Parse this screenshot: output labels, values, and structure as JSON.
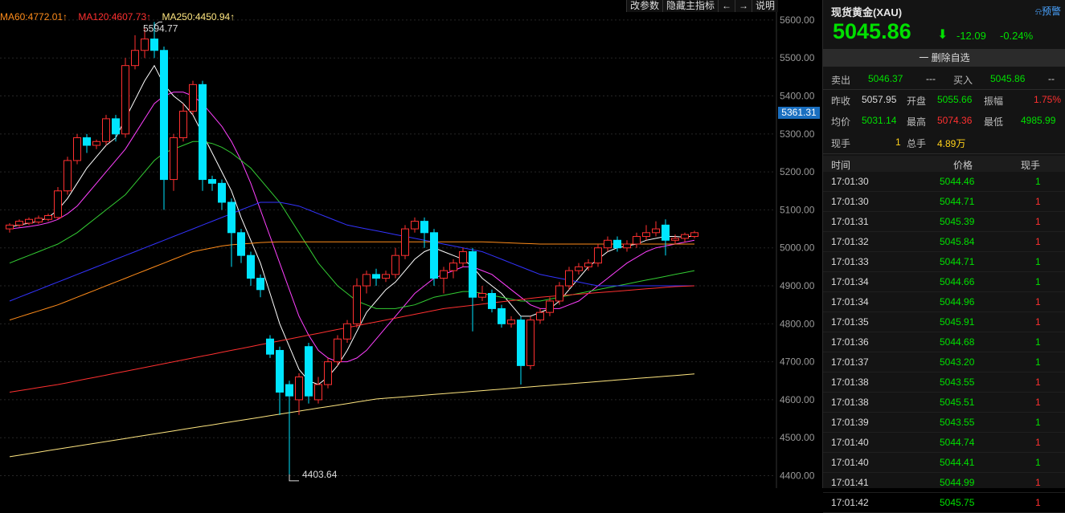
{
  "toolbar": {
    "buttons": [
      "改参数",
      "隐藏主指标",
      "←",
      "→",
      "说明"
    ]
  },
  "ma_legend": [
    {
      "label": "MA60:4772.01↑",
      "color": "#ff8c1a"
    },
    {
      "label": "MA120:4607.73↑",
      "color": "#ff3030"
    },
    {
      "label": "MA250:4450.94↑",
      "color": "#ffe680"
    }
  ],
  "chart_data": {
    "type": "candlestick",
    "y_ticks": [
      5600,
      5500,
      5400,
      5300,
      5200,
      5100,
      5000,
      4900,
      4800,
      4700,
      4600,
      4500,
      4400
    ],
    "y_tick_labels": [
      "5600.00",
      "5500.00",
      "5400.00",
      "5300.00",
      "5200.00",
      "5100.00",
      "5000.00",
      "4900.00",
      "4800.00",
      "4700.00",
      "4600.00",
      "4500.00",
      "4400.00"
    ],
    "ylim": [
      4380,
      5640
    ],
    "current_price_label": "5361.31",
    "current_price_value": 5361.31,
    "high_label": "5594.77",
    "high_value": 5594.77,
    "high_index": 15,
    "low_label": "4403.64",
    "low_value": 4403.64,
    "low_index": 29,
    "candles": [
      {
        "o": 5050,
        "c": 5060,
        "h": 5065,
        "l": 5040
      },
      {
        "o": 5060,
        "c": 5070,
        "h": 5075,
        "l": 5055
      },
      {
        "o": 5065,
        "c": 5075,
        "h": 5080,
        "l": 5060
      },
      {
        "o": 5068,
        "c": 5078,
        "h": 5085,
        "l": 5063
      },
      {
        "o": 5075,
        "c": 5085,
        "h": 5090,
        "l": 5070
      },
      {
        "o": 5080,
        "c": 5150,
        "h": 5160,
        "l": 5075
      },
      {
        "o": 5150,
        "c": 5230,
        "h": 5240,
        "l": 5140
      },
      {
        "o": 5230,
        "c": 5290,
        "h": 5300,
        "l": 5220
      },
      {
        "o": 5290,
        "c": 5270,
        "h": 5300,
        "l": 5250
      },
      {
        "o": 5270,
        "c": 5280,
        "h": 5285,
        "l": 5260
      },
      {
        "o": 5280,
        "c": 5340,
        "h": 5350,
        "l": 5270
      },
      {
        "o": 5340,
        "c": 5300,
        "h": 5350,
        "l": 5280
      },
      {
        "o": 5300,
        "c": 5480,
        "h": 5500,
        "l": 5290
      },
      {
        "o": 5480,
        "c": 5520,
        "h": 5560,
        "l": 5470
      },
      {
        "o": 5520,
        "c": 5550,
        "h": 5580,
        "l": 5500
      },
      {
        "o": 5550,
        "c": 5520,
        "h": 5594.77,
        "l": 5500
      },
      {
        "o": 5520,
        "c": 5180,
        "h": 5530,
        "l": 5100
      },
      {
        "o": 5180,
        "c": 5290,
        "h": 5300,
        "l": 5150
      },
      {
        "o": 5290,
        "c": 5360,
        "h": 5380,
        "l": 5280
      },
      {
        "o": 5360,
        "c": 5430,
        "h": 5440,
        "l": 5350
      },
      {
        "o": 5430,
        "c": 5180,
        "h": 5440,
        "l": 5150
      },
      {
        "o": 5180,
        "c": 5170,
        "h": 5190,
        "l": 5150
      },
      {
        "o": 5170,
        "c": 5120,
        "h": 5180,
        "l": 5100
      },
      {
        "o": 5120,
        "c": 5040,
        "h": 5130,
        "l": 4950
      },
      {
        "o": 5040,
        "c": 4980,
        "h": 5050,
        "l": 4960
      },
      {
        "o": 4980,
        "c": 4920,
        "h": 4990,
        "l": 4900
      },
      {
        "o": 4920,
        "c": 4890,
        "h": 4930,
        "l": 4870
      },
      {
        "o": 4760,
        "c": 4720,
        "h": 4770,
        "l": 4710
      },
      {
        "o": 4730,
        "c": 4620,
        "h": 4740,
        "l": 4560
      },
      {
        "o": 4640,
        "c": 4610,
        "h": 4650,
        "l": 4403.64
      },
      {
        "o": 4600,
        "c": 4660,
        "h": 4670,
        "l": 4560
      },
      {
        "o": 4740,
        "c": 4610,
        "h": 4750,
        "l": 4590
      },
      {
        "o": 4600,
        "c": 4640,
        "h": 4660,
        "l": 4590
      },
      {
        "o": 4640,
        "c": 4700,
        "h": 4710,
        "l": 4630
      },
      {
        "o": 4700,
        "c": 4760,
        "h": 4770,
        "l": 4690
      },
      {
        "o": 4760,
        "c": 4800,
        "h": 4810,
        "l": 4750
      },
      {
        "o": 4800,
        "c": 4900,
        "h": 4920,
        "l": 4790
      },
      {
        "o": 4900,
        "c": 4930,
        "h": 4940,
        "l": 4880
      },
      {
        "o": 4930,
        "c": 4920,
        "h": 4945,
        "l": 4900
      },
      {
        "o": 4920,
        "c": 4930,
        "h": 4940,
        "l": 4910
      },
      {
        "o": 4930,
        "c": 4980,
        "h": 5000,
        "l": 4920
      },
      {
        "o": 4980,
        "c": 5050,
        "h": 5060,
        "l": 4970
      },
      {
        "o": 5050,
        "c": 5070,
        "h": 5080,
        "l": 5040
      },
      {
        "o": 5070,
        "c": 5040,
        "h": 5080,
        "l": 5000
      },
      {
        "o": 5040,
        "c": 4920,
        "h": 5050,
        "l": 4900
      },
      {
        "o": 4920,
        "c": 4940,
        "h": 4950,
        "l": 4880
      },
      {
        "o": 4940,
        "c": 4960,
        "h": 4970,
        "l": 4920
      },
      {
        "o": 4960,
        "c": 4990,
        "h": 5000,
        "l": 4950
      },
      {
        "o": 4990,
        "c": 4870,
        "h": 5000,
        "l": 4780
      },
      {
        "o": 4870,
        "c": 4880,
        "h": 4900,
        "l": 4860
      },
      {
        "o": 4880,
        "c": 4840,
        "h": 4890,
        "l": 4830
      },
      {
        "o": 4840,
        "c": 4800,
        "h": 4850,
        "l": 4790
      },
      {
        "o": 4800,
        "c": 4810,
        "h": 4820,
        "l": 4790
      },
      {
        "o": 4810,
        "c": 4690,
        "h": 4820,
        "l": 4640
      },
      {
        "o": 4690,
        "c": 4810,
        "h": 4820,
        "l": 4680
      },
      {
        "o": 4810,
        "c": 4830,
        "h": 4840,
        "l": 4800
      },
      {
        "o": 4830,
        "c": 4860,
        "h": 4870,
        "l": 4820
      },
      {
        "o": 4860,
        "c": 4900,
        "h": 4910,
        "l": 4850
      },
      {
        "o": 4900,
        "c": 4940,
        "h": 4950,
        "l": 4890
      },
      {
        "o": 4940,
        "c": 4950,
        "h": 4960,
        "l": 4930
      },
      {
        "o": 4950,
        "c": 4960,
        "h": 4970,
        "l": 4940
      },
      {
        "o": 4960,
        "c": 5000,
        "h": 5010,
        "l": 4950
      },
      {
        "o": 5000,
        "c": 5020,
        "h": 5030,
        "l": 4990
      },
      {
        "o": 5020,
        "c": 5000,
        "h": 5030,
        "l": 4990
      },
      {
        "o": 5000,
        "c": 5010,
        "h": 5020,
        "l": 4990
      },
      {
        "o": 5010,
        "c": 5030,
        "h": 5040,
        "l": 5000
      },
      {
        "o": 5030,
        "c": 5040,
        "h": 5060,
        "l": 5020
      },
      {
        "o": 5040,
        "c": 5050,
        "h": 5070,
        "l": 5030
      },
      {
        "o": 5060,
        "c": 5020,
        "h": 5075,
        "l": 4980
      },
      {
        "o": 5020,
        "c": 5025,
        "h": 5035,
        "l": 5010
      },
      {
        "o": 5025,
        "c": 5035,
        "h": 5040,
        "l": 5015
      },
      {
        "o": 5030,
        "c": 5040,
        "h": 5045,
        "l": 5025
      }
    ],
    "ma_lines": [
      {
        "name": "MA5",
        "color": "#ffffff",
        "values": [
          5055,
          5060,
          5065,
          5070,
          5080,
          5100,
          5130,
          5170,
          5210,
          5240,
          5270,
          5290,
          5340,
          5390,
          5440,
          5480,
          5430,
          5400,
          5380,
          5350,
          5300,
          5250,
          5200,
          5150,
          5080,
          5020,
          4960,
          4880,
          4800,
          4740,
          4680,
          4650,
          4640,
          4660,
          4690,
          4730,
          4780,
          4830,
          4860,
          4890,
          4910,
          4940,
          4970,
          4990,
          5000,
          4990,
          4980,
          4970,
          4950,
          4920,
          4900,
          4880,
          4850,
          4820,
          4820,
          4830,
          4840,
          4860,
          4890,
          4920,
          4950,
          4970,
          4990,
          5000,
          5005,
          5010,
          5020,
          5025,
          5030,
          5030,
          5028,
          5032
        ]
      },
      {
        "name": "MA10",
        "color": "#ff40ff",
        "values": [
          5050,
          5053,
          5056,
          5060,
          5066,
          5075,
          5090,
          5110,
          5140,
          5170,
          5200,
          5230,
          5260,
          5300,
          5340,
          5380,
          5400,
          5410,
          5410,
          5400,
          5380,
          5350,
          5320,
          5280,
          5230,
          5170,
          5100,
          5030,
          4960,
          4890,
          4820,
          4770,
          4730,
          4710,
          4700,
          4700,
          4710,
          4730,
          4760,
          4790,
          4820,
          4850,
          4880,
          4900,
          4920,
          4930,
          4940,
          4950,
          4950,
          4940,
          4930,
          4910,
          4890,
          4870,
          4850,
          4840,
          4840,
          4840,
          4850,
          4860,
          4880,
          4900,
          4920,
          4940,
          4960,
          4975,
          4990,
          5000,
          5005,
          5010,
          5015,
          5020
        ]
      },
      {
        "name": "MA20",
        "color": "#33cc33",
        "values": [
          4960,
          4970,
          4980,
          4990,
          5000,
          5010,
          5025,
          5040,
          5060,
          5080,
          5100,
          5120,
          5140,
          5170,
          5200,
          5230,
          5250,
          5260,
          5270,
          5280,
          5280,
          5275,
          5265,
          5250,
          5230,
          5210,
          5180,
          5150,
          5120,
          5080,
          5040,
          5000,
          4960,
          4930,
          4900,
          4880,
          4860,
          4850,
          4840,
          4840,
          4840,
          4845,
          4850,
          4860,
          4870,
          4875,
          4880,
          4885,
          4885,
          4880,
          4875,
          4870,
          4865,
          4860,
          4860,
          4860,
          4865,
          4870,
          4875,
          4880,
          4885,
          4890,
          4895,
          4900,
          4905,
          4910,
          4915,
          4920,
          4925,
          4930,
          4935,
          4940
        ]
      },
      {
        "name": "MA40",
        "color": "#3333ff",
        "values": [
          4860,
          4870,
          4880,
          4890,
          4900,
          4910,
          4920,
          4930,
          4940,
          4950,
          4960,
          4970,
          4980,
          4990,
          5000,
          5010,
          5020,
          5030,
          5040,
          5050,
          5060,
          5070,
          5080,
          5090,
          5100,
          5110,
          5120,
          5120,
          5120,
          5115,
          5110,
          5100,
          5090,
          5080,
          5070,
          5060,
          5055,
          5050,
          5045,
          5040,
          5035,
          5030,
          5025,
          5020,
          5015,
          5010,
          5005,
          5000,
          4995,
          4990,
          4980,
          4970,
          4960,
          4950,
          4940,
          4930,
          4925,
          4920,
          4915,
          4910,
          4905,
          4900,
          4900,
          4900,
          4900,
          4900,
          4900,
          4900,
          4900,
          4900,
          4900,
          4900
        ]
      },
      {
        "name": "MA60",
        "color": "#ff8c1a",
        "values": [
          4810,
          4818,
          4826,
          4834,
          4842,
          4850,
          4860,
          4870,
          4880,
          4890,
          4900,
          4910,
          4920,
          4930,
          4940,
          4950,
          4960,
          4970,
          4980,
          4990,
          4995,
          5000,
          5005,
          5008,
          5010,
          5012,
          5014,
          5015,
          5016,
          5016,
          5016,
          5016,
          5016,
          5016,
          5016,
          5016,
          5016,
          5016,
          5016,
          5016,
          5016,
          5016,
          5016,
          5016,
          5016,
          5016,
          5016,
          5016,
          5016,
          5016,
          5015,
          5014,
          5013,
          5012,
          5011,
          5010,
          5010,
          5010,
          5010,
          5010,
          5010,
          5010,
          5010,
          5010,
          5010,
          5010,
          5010,
          5010,
          5010,
          5010,
          5010,
          5010
        ]
      },
      {
        "name": "MA120",
        "color": "#ff3030",
        "values": [
          4620,
          4624,
          4628,
          4632,
          4636,
          4640,
          4645,
          4650,
          4655,
          4660,
          4665,
          4670,
          4675,
          4680,
          4685,
          4690,
          4695,
          4700,
          4705,
          4710,
          4715,
          4720,
          4725,
          4730,
          4735,
          4740,
          4745,
          4750,
          4755,
          4760,
          4765,
          4770,
          4775,
          4780,
          4785,
          4790,
          4795,
          4800,
          4805,
          4810,
          4815,
          4820,
          4825,
          4830,
          4835,
          4840,
          4843,
          4846,
          4849,
          4852,
          4855,
          4858,
          4861,
          4864,
          4867,
          4870,
          4872,
          4874,
          4876,
          4878,
          4880,
          4882,
          4884,
          4886,
          4888,
          4890,
          4892,
          4894,
          4896,
          4898,
          4899,
          4900
        ]
      },
      {
        "name": "MA250",
        "color": "#ffe680",
        "values": [
          4450,
          4454,
          4458,
          4462,
          4466,
          4470,
          4474,
          4478,
          4482,
          4486,
          4490,
          4494,
          4498,
          4502,
          4506,
          4510,
          4514,
          4518,
          4522,
          4526,
          4530,
          4534,
          4538,
          4542,
          4546,
          4550,
          4554,
          4558,
          4562,
          4566,
          4570,
          4574,
          4578,
          4582,
          4586,
          4590,
          4594,
          4598,
          4602,
          4604,
          4606,
          4608,
          4610,
          4612,
          4614,
          4616,
          4618,
          4620,
          4622,
          4624,
          4626,
          4628,
          4630,
          4632,
          4634,
          4636,
          4638,
          4640,
          4642,
          4644,
          4646,
          4648,
          4650,
          4652,
          4654,
          4656,
          4658,
          4660,
          4662,
          4664,
          4666,
          4668
        ]
      }
    ]
  },
  "quote": {
    "title": "现货黄金(XAU)",
    "warn_label": "预警",
    "price": "5045.86",
    "arrow": "⬇",
    "change": "-12.09",
    "change_pct": "-0.24%",
    "delete_label": "一 删除自选",
    "sell_label": "卖出",
    "sell_value": "5046.37",
    "sell_extra": "---",
    "buy_label": "买入",
    "buy_value": "5045.86",
    "buy_extra": "--",
    "prev_close_label": "昨收",
    "prev_close": "5057.95",
    "open_label": "开盘",
    "open": "5055.66",
    "amplitude_label": "振幅",
    "amplitude": "1.75%",
    "avg_label": "均价",
    "avg": "5031.14",
    "high_label": "最高",
    "high": "5074.36",
    "low_label": "最低",
    "low": "4985.99",
    "cur_vol_label": "现手",
    "cur_vol": "1",
    "total_vol_label": "总手",
    "total_vol": "4.89万"
  },
  "ticks": {
    "headers": [
      "时间",
      "价格",
      "现手"
    ],
    "rows": [
      {
        "time": "17:01:30",
        "price": "5044.46",
        "vol": "1",
        "vol_color": "#00e000"
      },
      {
        "time": "17:01:30",
        "price": "5044.71",
        "vol": "1",
        "vol_color": "#ff3030"
      },
      {
        "time": "17:01:31",
        "price": "5045.39",
        "vol": "1",
        "vol_color": "#ff3030"
      },
      {
        "time": "17:01:32",
        "price": "5045.84",
        "vol": "1",
        "vol_color": "#ff3030"
      },
      {
        "time": "17:01:33",
        "price": "5044.71",
        "vol": "1",
        "vol_color": "#00e000"
      },
      {
        "time": "17:01:34",
        "price": "5044.66",
        "vol": "1",
        "vol_color": "#00e000"
      },
      {
        "time": "17:01:34",
        "price": "5044.96",
        "vol": "1",
        "vol_color": "#ff3030"
      },
      {
        "time": "17:01:35",
        "price": "5045.91",
        "vol": "1",
        "vol_color": "#ff3030"
      },
      {
        "time": "17:01:36",
        "price": "5044.68",
        "vol": "1",
        "vol_color": "#00e000"
      },
      {
        "time": "17:01:37",
        "price": "5043.20",
        "vol": "1",
        "vol_color": "#00e000"
      },
      {
        "time": "17:01:38",
        "price": "5043.55",
        "vol": "1",
        "vol_color": "#ff3030"
      },
      {
        "time": "17:01:38",
        "price": "5045.51",
        "vol": "1",
        "vol_color": "#ff3030"
      },
      {
        "time": "17:01:39",
        "price": "5043.55",
        "vol": "1",
        "vol_color": "#00e000"
      },
      {
        "time": "17:01:40",
        "price": "5044.74",
        "vol": "1",
        "vol_color": "#ff3030"
      },
      {
        "time": "17:01:40",
        "price": "5044.41",
        "vol": "1",
        "vol_color": "#00e000"
      },
      {
        "time": "17:01:41",
        "price": "5044.99",
        "vol": "1",
        "vol_color": "#ff3030"
      },
      {
        "time": "17:01:42",
        "price": "5045.75",
        "vol": "1",
        "vol_color": "#ff3030"
      }
    ]
  },
  "colors": {
    "up": "#ff3030",
    "down": "#00e5ff",
    "bg": "#000000",
    "grid": "#262626",
    "axis_text": "#999999"
  }
}
